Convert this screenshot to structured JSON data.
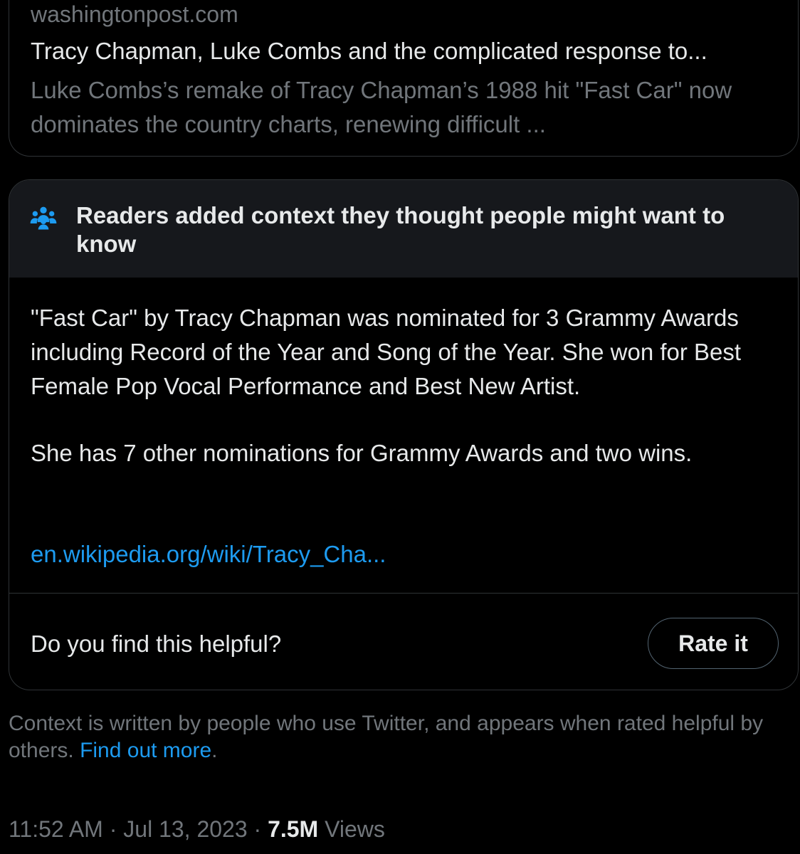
{
  "link_card": {
    "domain": "washingtonpost.com",
    "title": "Tracy Chapman, Luke Combs and the complicated response to...",
    "description": "Luke Combs’s remake of Tracy Chapman’s 1988 hit \"Fast Car\" now dominates the country charts, renewing difficult ..."
  },
  "community_note": {
    "icon": "people-icon",
    "heading": "Readers added context they thought people might want to know",
    "paragraphs": [
      "\"Fast Car\" by Tracy Chapman was nominated for 3 Grammy Awards including Record of the Year and Song of the Year.  She won for Best Female Pop Vocal Performance and Best New Artist.",
      "She has 7 other nominations for Grammy Awards and two wins."
    ],
    "source_link": "en.wikipedia.org/wiki/Tracy_Cha...",
    "helpful_question": "Do you find this helpful?",
    "rate_button_label": "Rate it"
  },
  "footnote": {
    "text": "Context is written by people who use Twitter, and appears when rated helpful by others.",
    "link_label": "Find out more",
    "trailing": "."
  },
  "meta": {
    "time": "11:52 AM",
    "separator": "·",
    "date": "Jul 13, 2023",
    "views_count": "7.5M",
    "views_label": "Views"
  },
  "colors": {
    "background": "#000000",
    "primary_text": "#e7e9ea",
    "secondary_text": "#71767b",
    "link": "#1d9bf0",
    "border": "#2f3336",
    "note_header_bg": "#16181c",
    "icon": "#1d9bf0"
  }
}
